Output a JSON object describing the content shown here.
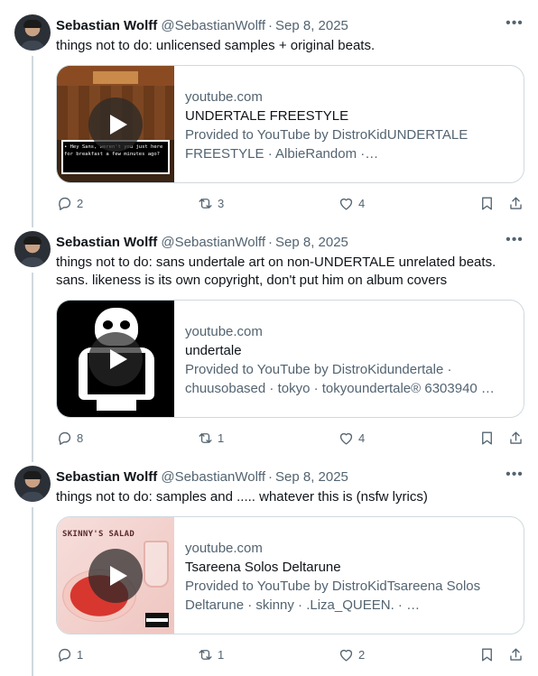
{
  "tweets": [
    {
      "author_name": "Sebastian Wolff",
      "author_handle": "@SebastianWolff",
      "date": "Sep 8, 2025",
      "text": "things not to do: unlicensed samples + original beats.",
      "card": {
        "domain": "youtube.com",
        "title": "UNDERTALE FREESTYLE",
        "description": "Provided to YouTube by DistroKidUNDERTALE FREESTYLE · AlbieRandom · MythicApexUNDERTALE …",
        "thumbnail_text": "• Hey Sans, weren't you just here for breakfast a few minutes ago?"
      },
      "replies": "2",
      "reposts": "3",
      "likes": "4"
    },
    {
      "author_name": "Sebastian Wolff",
      "author_handle": "@SebastianWolff",
      "date": "Sep 8, 2025",
      "text": "things not to do: sans undertale art on non-UNDERTALE unrelated beats. sans. likeness is its own copyright, don't put him on album covers",
      "card": {
        "domain": "youtube.com",
        "title": "undertale",
        "description": "Provided to YouTube by DistroKidundertale · chuusobased · tokyo · tokyoundertale® 6303940 …"
      },
      "replies": "8",
      "reposts": "1",
      "likes": "4"
    },
    {
      "author_name": "Sebastian Wolff",
      "author_handle": "@SebastianWolff",
      "date": "Sep 8, 2025",
      "text": "things not to do: samples and ..... whatever this is (nsfw lyrics)",
      "card": {
        "domain": "youtube.com",
        "title": "Tsareena Solos Deltarune",
        "description": "Provided to YouTube by DistroKidTsareena Solos Deltarune · skinny · .Liza_QUEEN. · …",
        "thumbnail_text": "SKINNY'S SALAD"
      },
      "replies": "1",
      "reposts": "1",
      "likes": "2"
    }
  ],
  "icons": {
    "more": "more-horizontal-icon",
    "reply": "reply-icon",
    "repost": "repost-icon",
    "like": "heart-icon",
    "bookmark": "bookmark-icon",
    "share": "share-icon"
  },
  "colors": {
    "text": "#0f1419",
    "secondary": "#536471",
    "border": "#cfd9de"
  }
}
